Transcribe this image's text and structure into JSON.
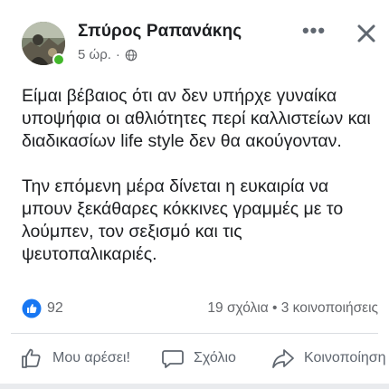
{
  "author": {
    "name": "Σπύρος Ραπανάκης",
    "time": "5 ώρ.",
    "separator": "·",
    "privacy_icon": "globe-icon",
    "online": true
  },
  "header_actions": {
    "more_icon": "more-dots-icon",
    "more_label": "•••",
    "close_icon": "close-icon"
  },
  "post": {
    "paragraphs": [
      "Είμαι βέβαιος ότι αν δεν υπήρχε γυναίκα υποψήφια οι αθλιότητες περί καλλιστείων και διαδικασίων life style δεν θα ακούγονταν.",
      "Την επόμενη μέρα δίνεται η ευκαιρία να μπουν ξεκάθαρες κόκκινες γραμμές με το λούμπεν, τον σεξισμό και τις ψευτοπαλικαριές."
    ]
  },
  "stats": {
    "reaction_icon": "like-reaction-icon",
    "reactions": "92",
    "comments_shares": "19 σχόλια • 3 κοινοποιήσεις"
  },
  "actions": {
    "like": {
      "label": "Μου αρέσει!",
      "icon": "thumbs-up-icon"
    },
    "comment": {
      "label": "Σχόλιο",
      "icon": "comment-bubble-icon"
    },
    "share": {
      "label": "Κοινοποίηση",
      "icon": "share-arrow-icon"
    }
  },
  "colors": {
    "text": "#1c1e21",
    "secondary": "#65676b",
    "online": "#42b72a",
    "like_blue": "#1877f2",
    "divider": "#dadde1"
  }
}
